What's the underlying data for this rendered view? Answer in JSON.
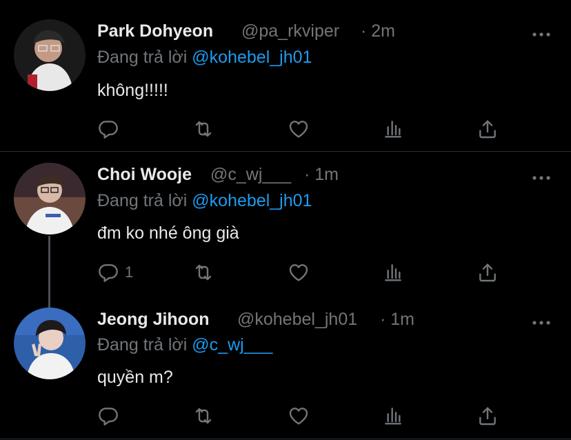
{
  "colors": {
    "background": "#000000",
    "name": "#e7e9ea",
    "muted": "#71767b",
    "accent": "#1d9bf0",
    "divider": "#2f3336"
  },
  "tweets": [
    {
      "display_name": "Park Dohyeon",
      "handle": "@pa_rkviper",
      "time": "· 2m",
      "reply_prefix": "Đang trả lời",
      "reply_to": "@kohebel_jh01",
      "text": "không!!!!!",
      "reply_count": ""
    },
    {
      "display_name": "Choi Wooje",
      "handle": "@c_wj___",
      "time": "· 1m",
      "reply_prefix": "Đang trả lời",
      "reply_to": "@kohebel_jh01",
      "text": "đm ko nhé ông già",
      "reply_count": "1"
    },
    {
      "display_name": "Jeong Jihoon",
      "handle": "@kohebel_jh01",
      "time": "· 1m",
      "reply_prefix": "Đang trả lời",
      "reply_to": "@c_wj___",
      "text": "quyền m?",
      "reply_count": ""
    }
  ],
  "icons": [
    "reply-icon",
    "retweet-icon",
    "like-icon",
    "analytics-icon",
    "share-icon",
    "more-icon"
  ]
}
